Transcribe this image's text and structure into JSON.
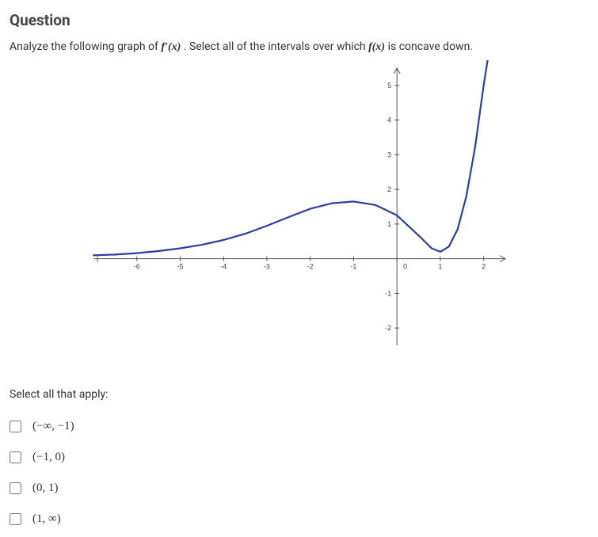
{
  "heading": "Question",
  "prompt_pre": "Analyze the following graph of ",
  "prompt_f1": "f′(x)",
  "prompt_mid": ". Select all of the intervals over which ",
  "prompt_f2": "f(x)",
  "prompt_post": " is concave down.",
  "select_label": "Select all that apply:",
  "options": [
    {
      "label": "(−∞, −1)"
    },
    {
      "label": "(−1, 0)"
    },
    {
      "label": "(0, 1)"
    },
    {
      "label": "(1, ∞)"
    }
  ],
  "chart_data": {
    "type": "line",
    "title": "",
    "xlabel": "",
    "ylabel": "",
    "xlim": [
      -7,
      2.5
    ],
    "ylim": [
      -2.5,
      5.5
    ],
    "x_ticks": [
      -6,
      -5,
      -4,
      -3,
      -2,
      -1,
      0,
      1,
      2
    ],
    "y_ticks": [
      -2,
      -1,
      0,
      1,
      2,
      3,
      4,
      5
    ],
    "series": [
      {
        "name": "f'(x)",
        "color": "#2b3ea8",
        "points": [
          [
            -7.0,
            0.1
          ],
          [
            -6.5,
            0.12
          ],
          [
            -6.0,
            0.16
          ],
          [
            -5.5,
            0.22
          ],
          [
            -5.0,
            0.3
          ],
          [
            -4.5,
            0.4
          ],
          [
            -4.0,
            0.54
          ],
          [
            -3.5,
            0.72
          ],
          [
            -3.0,
            0.95
          ],
          [
            -2.5,
            1.2
          ],
          [
            -2.0,
            1.44
          ],
          [
            -1.5,
            1.6
          ],
          [
            -1.0,
            1.65
          ],
          [
            -0.5,
            1.55
          ],
          [
            0.0,
            1.25
          ],
          [
            0.3,
            0.9
          ],
          [
            0.6,
            0.55
          ],
          [
            0.8,
            0.3
          ],
          [
            1.0,
            0.2
          ],
          [
            1.2,
            0.35
          ],
          [
            1.4,
            0.85
          ],
          [
            1.6,
            1.8
          ],
          [
            1.8,
            3.2
          ],
          [
            2.0,
            5.0
          ],
          [
            2.1,
            5.8
          ]
        ]
      }
    ]
  }
}
